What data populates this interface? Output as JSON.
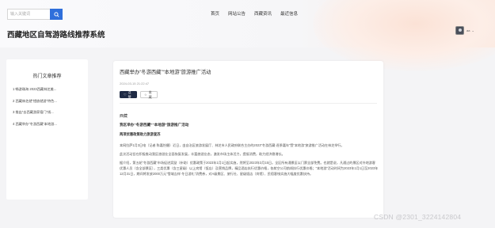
{
  "header": {
    "search": {
      "placeholder": "输入关键词"
    },
    "nav": [
      "首页",
      "网站公告",
      "西藏资讯",
      "最近信息"
    ],
    "site_title": "西藏地区自驾游路线推荐系统",
    "user": {
      "name": "aa",
      "caret": "⌄"
    }
  },
  "sidebar": {
    "title": "热门文章推荐",
    "items": [
      "1 畅游珠海 2023西藏林芝美...",
      "2 西藏林芝就“错放就游”特色...",
      "3 推出“去西藏游家宿门”线...",
      "4 西藏举办“冬游西藏”本地游..."
    ]
  },
  "article": {
    "title": "西藏举办“冬游西藏”“本地游”旅游推广活动",
    "date": "2024-03-15 21:22:47",
    "like_label": "点赞",
    "collect_label": "收藏",
    "category": "西藏",
    "heading": "我区举办“冬游西藏”“本地游”旅游推广活动",
    "subheading": "两项优惠政策助力旅游复苏",
    "paragraphs": [
      "本网拉萨1月3日电（记者 陈嘉怡摄）近日，由自治区旅游发展厅、林芝市人民政府联合主办的2023“冬游西藏·逐季嘉年”暨“本地游”旅游推广活动在林芝举行。",
      "此次活动旨在积极推动我区旅游业全面恢复发展，丰富旅游业态，激发市场主体活力，提振消费，助力经济稳增长。",
      "据介绍，第五轮“冬游西藏”市场促进奖励（补助）优惠政策于2023年1月1日起实施，然将至2023年3月15日。全区所有通景区以门票全部免费。也就是说，凡通过的景区对外地游客优惠人员（含全部景区），三类优惠（含三星级）以上宾馆（饭店）及营销品牌，精品酒店执行优惠价格，各航空公司航线执行优惠价格；“本地游”活动时间为2023年1月1日至2023年12月31日，期间将发放2000万元“雪域吉祥·冬日游礼”消费券，对A级景区、旅行社、星级饭店（宾馆）、民宿客栈实施大幅度优惠扶持。"
    ]
  },
  "watermark": "CSDN @2301_3224142804",
  "colors": {
    "accent": "#2f6fdb",
    "primary_button": "#1f2b45"
  }
}
